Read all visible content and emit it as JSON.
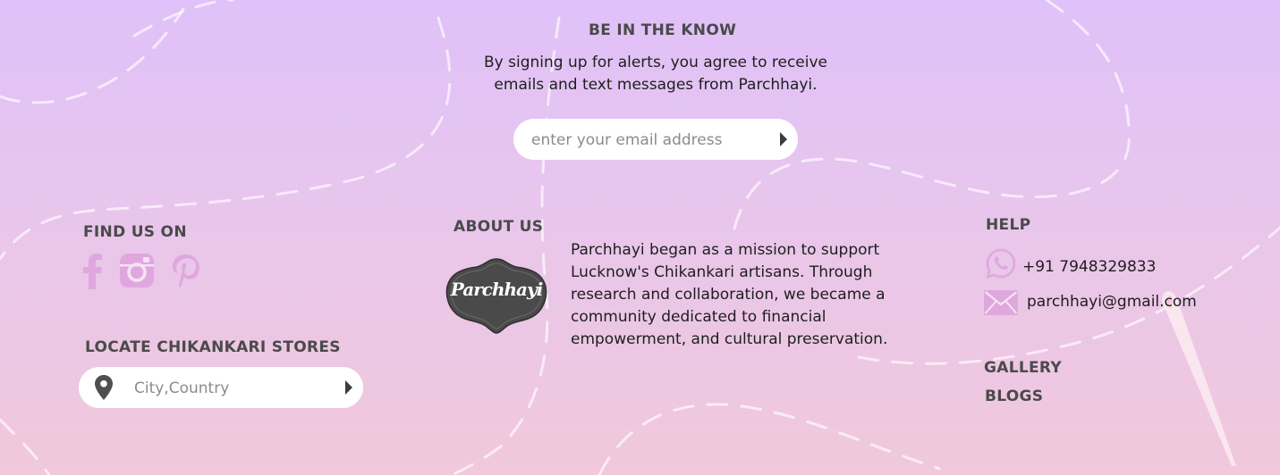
{
  "newsletter": {
    "heading": "BE IN THE KNOW",
    "description_line1": "By signing up for alerts, you agree to receive",
    "description_line2": "emails and text messages from Parchhayi.",
    "email_placeholder": "enter your email address"
  },
  "social": {
    "heading": "FIND US ON",
    "icons": [
      "facebook-icon",
      "instagram-icon",
      "pinterest-icon"
    ],
    "icon_color": "#e0a7df"
  },
  "store_locator": {
    "heading": "LOCATE CHIKANKARI STORES",
    "placeholder": "City,Country"
  },
  "about": {
    "heading": "ABOUT US",
    "logo_text": "Parchhayi",
    "lines": [
      "Parchhayi began as a mission to support",
      "Lucknow's Chikankari artisans. Through",
      "research and collaboration, we became a",
      "community dedicated to financial",
      "empowerment, and cultural preservation."
    ]
  },
  "help": {
    "heading": "HELP",
    "phone": "+91 7948329833",
    "email": "parchhayi@gmail.com",
    "links": [
      "GALLERY",
      "BLOGS"
    ]
  },
  "colors": {
    "gradient_top": "#e0c1f9",
    "gradient_bottom": "#f1c8dc",
    "heading_text": "#4a4a4a",
    "logo_fill": "#4a4a4a",
    "icon_pink": "#e0a7df",
    "thread_dash": "#ffffff"
  }
}
